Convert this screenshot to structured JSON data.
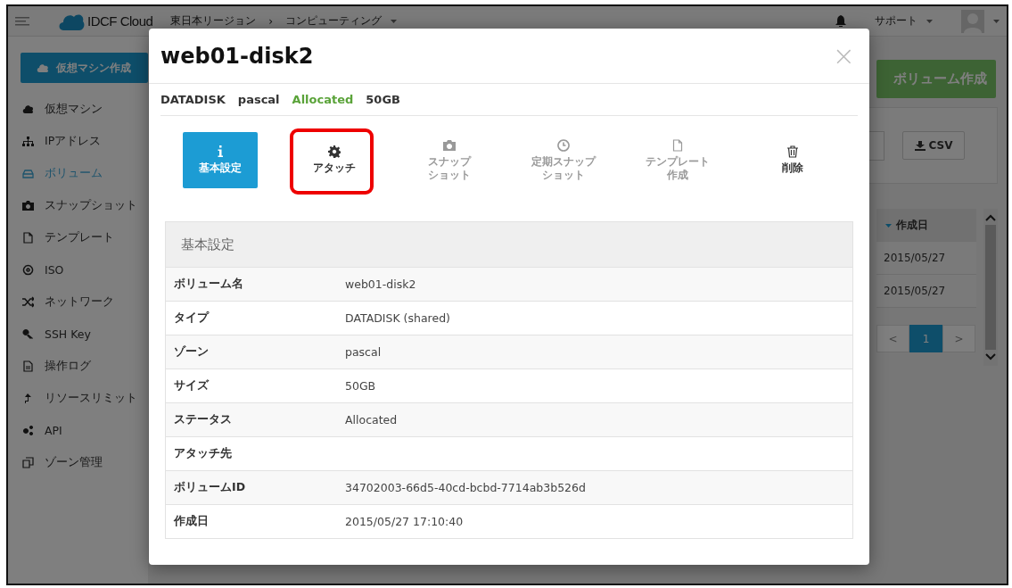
{
  "header": {
    "logo": "IDCF Cloud",
    "breadcrumb": [
      "東日本リージョン",
      "›",
      "コンピューティング"
    ],
    "support": "サポート"
  },
  "sidebar": {
    "create_button": "仮想マシン作成",
    "items": [
      {
        "label": "仮想マシン",
        "selected": false
      },
      {
        "label": "IPアドレス",
        "selected": false
      },
      {
        "label": "ボリューム",
        "selected": true
      },
      {
        "label": "スナップショット",
        "selected": false
      },
      {
        "label": "テンプレート",
        "selected": false
      },
      {
        "label": "ISO",
        "selected": false
      },
      {
        "label": "ネットワーク",
        "selected": false
      },
      {
        "label": "SSH Key",
        "selected": false
      },
      {
        "label": "操作ログ",
        "selected": false
      },
      {
        "label": "リソースリミット",
        "selected": false
      },
      {
        "label": "API",
        "selected": false
      },
      {
        "label": "ゾーン管理",
        "selected": false
      }
    ]
  },
  "main": {
    "create_button": "ボリューム作成",
    "csv_button": "CSV",
    "table": {
      "columns": [
        {
          "label": "作成日",
          "sorted": true
        }
      ],
      "rows": [
        [
          "2015/05/27"
        ],
        [
          "2015/05/27"
        ]
      ]
    },
    "pagination": {
      "prev": "<",
      "pages": [
        {
          "label": "1",
          "selected": true
        }
      ],
      "next": ">"
    }
  },
  "dialog": {
    "title": "web01-disk2",
    "close": "×",
    "summary": [
      {
        "text": "DATADISK",
        "kind": "plain"
      },
      {
        "text": "pascal",
        "kind": "plain"
      },
      {
        "text": "Allocated",
        "kind": "status"
      },
      {
        "text": "50GB",
        "kind": "plain"
      }
    ],
    "actions": [
      {
        "lines": [
          "基本設定"
        ],
        "selected": true,
        "disabled": false,
        "highlighted": false
      },
      {
        "lines": [
          "アタッチ"
        ],
        "selected": false,
        "disabled": false,
        "highlighted": true
      },
      {
        "lines": [
          "スナップ",
          "ショット"
        ],
        "selected": false,
        "disabled": true,
        "highlighted": false
      },
      {
        "lines": [
          "定期スナップ",
          "ショット"
        ],
        "selected": false,
        "disabled": true,
        "highlighted": false
      },
      {
        "lines": [
          "テンプレート",
          "作成"
        ],
        "selected": false,
        "disabled": true,
        "highlighted": false
      },
      {
        "lines": [
          "削除"
        ],
        "selected": false,
        "disabled": false,
        "highlighted": false
      }
    ],
    "panel_title": "基本設定",
    "details": [
      {
        "label": "ボリューム名",
        "value": "web01-disk2"
      },
      {
        "label": "タイプ",
        "value": "DATADISK (shared)"
      },
      {
        "label": "ゾーン",
        "value": "pascal"
      },
      {
        "label": "サイズ",
        "value": "50GB"
      },
      {
        "label": "ステータス",
        "value": "Allocated"
      },
      {
        "label": "アタッチ先"
      },
      {
        "label": "ボリュームID",
        "value": "34702003-66d5-40cd-bcbd-7714ab3b526d"
      },
      {
        "label": "作成日",
        "value": "2015/05/27 17:10:40"
      }
    ]
  }
}
